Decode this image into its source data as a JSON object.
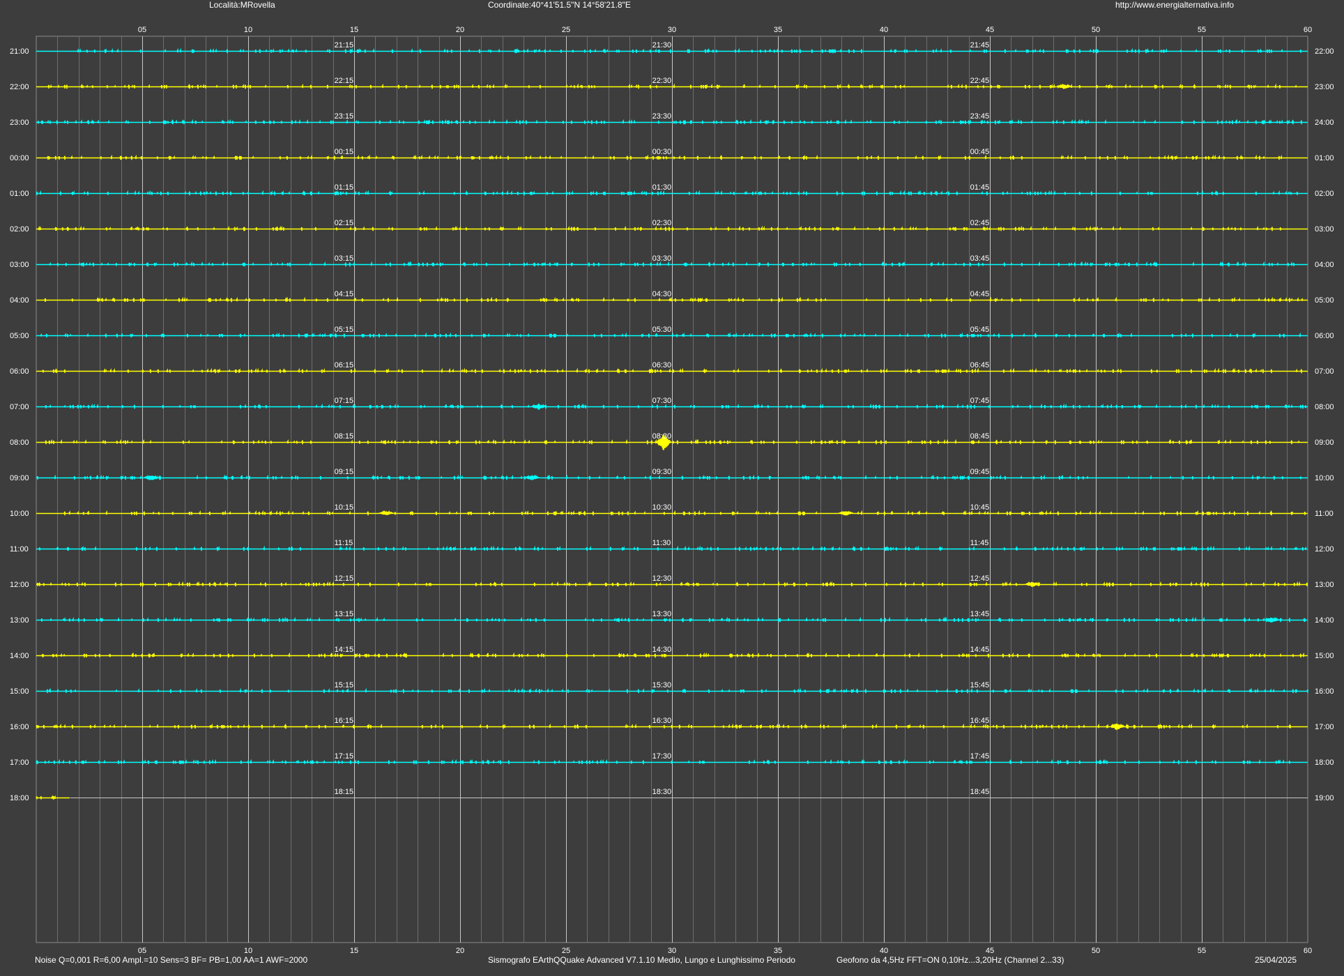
{
  "header": {
    "location": "Località:MRovella",
    "coordinates": "Coordinate:40°41'51.5\"N 14°58'21.8\"E",
    "url": "http://www.energialternativa.info"
  },
  "footer": {
    "params": "Noise Q=0,001 R=6,00 Ampl.=10 Sens=3 BF= PB=1,00 AA=1 AWF=2000",
    "software": "Sismografo  EArthQQuake Advanced V7.1.10  Medio, Lungo e Lunghissimo Periodo",
    "sensor": "Geofono da 4,5Hz FFT=ON 0,10Hz...3,20Hz      (Channel 2...33)",
    "date": "25/04/2025"
  },
  "chart_data": {
    "type": "line",
    "colors": {
      "background": "#3d3d3d",
      "grid": "#8c8c8c",
      "trace_a": "#00ffff",
      "trace_b": "#ffff00",
      "text": "#ffffff"
    },
    "x_ticks": [
      "05",
      "10",
      "15",
      "20",
      "25",
      "30",
      "35",
      "40",
      "45",
      "50",
      "55",
      "60"
    ],
    "x_range": [
      0,
      60
    ],
    "rows": [
      {
        "left": "21:00",
        "right": "22:00",
        "q1": "21:15",
        "q2": "21:30",
        "q3": "21:45",
        "color": "cyan"
      },
      {
        "left": "22:00",
        "right": "23:00",
        "q1": "22:15",
        "q2": "22:30",
        "q3": "22:45",
        "color": "yellow"
      },
      {
        "left": "23:00",
        "right": "24:00",
        "q1": "23:15",
        "q2": "23:30",
        "q3": "23:45",
        "color": "cyan"
      },
      {
        "left": "00:00",
        "right": "01:00",
        "q1": "00:15",
        "q2": "00:30",
        "q3": "00:45",
        "color": "yellow"
      },
      {
        "left": "01:00",
        "right": "02:00",
        "q1": "01:15",
        "q2": "01:30",
        "q3": "01:45",
        "color": "cyan"
      },
      {
        "left": "02:00",
        "right": "03:00",
        "q1": "02:15",
        "q2": "02:30",
        "q3": "02:45",
        "color": "yellow"
      },
      {
        "left": "03:00",
        "right": "04:00",
        "q1": "03:15",
        "q2": "03:30",
        "q3": "03:45",
        "color": "cyan"
      },
      {
        "left": "04:00",
        "right": "05:00",
        "q1": "04:15",
        "q2": "04:30",
        "q3": "04:45",
        "color": "yellow"
      },
      {
        "left": "05:00",
        "right": "06:00",
        "q1": "05:15",
        "q2": "05:30",
        "q3": "05:45",
        "color": "cyan"
      },
      {
        "left": "06:00",
        "right": "07:00",
        "q1": "06:15",
        "q2": "06:30",
        "q3": "06:45",
        "color": "yellow"
      },
      {
        "left": "07:00",
        "right": "08:00",
        "q1": "07:15",
        "q2": "07:30",
        "q3": "07:45",
        "color": "cyan"
      },
      {
        "left": "08:00",
        "right": "09:00",
        "q1": "08:15",
        "q2": "08:30",
        "q3": "08:45",
        "color": "yellow"
      },
      {
        "left": "09:00",
        "right": "10:00",
        "q1": "09:15",
        "q2": "09:30",
        "q3": "09:45",
        "color": "cyan"
      },
      {
        "left": "10:00",
        "right": "11:00",
        "q1": "10:15",
        "q2": "10:30",
        "q3": "10:45",
        "color": "yellow"
      },
      {
        "left": "11:00",
        "right": "12:00",
        "q1": "11:15",
        "q2": "11:30",
        "q3": "11:45",
        "color": "cyan"
      },
      {
        "left": "12:00",
        "right": "13:00",
        "q1": "12:15",
        "q2": "12:30",
        "q3": "12:45",
        "color": "yellow"
      },
      {
        "left": "13:00",
        "right": "14:00",
        "q1": "13:15",
        "q2": "13:30",
        "q3": "13:45",
        "color": "cyan"
      },
      {
        "left": "14:00",
        "right": "15:00",
        "q1": "14:15",
        "q2": "14:30",
        "q3": "14:45",
        "color": "yellow"
      },
      {
        "left": "15:00",
        "right": "16:00",
        "q1": "15:15",
        "q2": "15:30",
        "q3": "15:45",
        "color": "cyan"
      },
      {
        "left": "16:00",
        "right": "17:00",
        "q1": "16:15",
        "q2": "16:30",
        "q3": "16:45",
        "color": "yellow"
      },
      {
        "left": "17:00",
        "right": "18:00",
        "q1": "17:15",
        "q2": "17:30",
        "q3": "17:45",
        "color": "cyan"
      },
      {
        "left": "18:00",
        "right": "19:00",
        "q1": "18:15",
        "q2": "18:30",
        "q3": "18:45",
        "color": "yellow",
        "end_minute": 1.6
      }
    ],
    "events": [
      {
        "row": "08:00",
        "minute": 29.6,
        "amplitude": 1.0
      },
      {
        "row": "09:00",
        "minute": 5.4,
        "amplitude": 0.35
      },
      {
        "row": "09:00",
        "minute": 23.4,
        "amplitude": 0.3
      },
      {
        "row": "10:00",
        "minute": 16.5,
        "amplitude": 0.25
      },
      {
        "row": "10:00",
        "minute": 38.2,
        "amplitude": 0.3
      },
      {
        "row": "12:00",
        "minute": 47.0,
        "amplitude": 0.3
      },
      {
        "row": "13:00",
        "minute": 58.3,
        "amplitude": 0.35
      },
      {
        "row": "16:00",
        "minute": 51.0,
        "amplitude": 0.45
      },
      {
        "row": "22:00",
        "minute": 48.5,
        "amplitude": 0.3
      },
      {
        "row": "07:00",
        "minute": 23.7,
        "amplitude": 0.4
      }
    ]
  }
}
